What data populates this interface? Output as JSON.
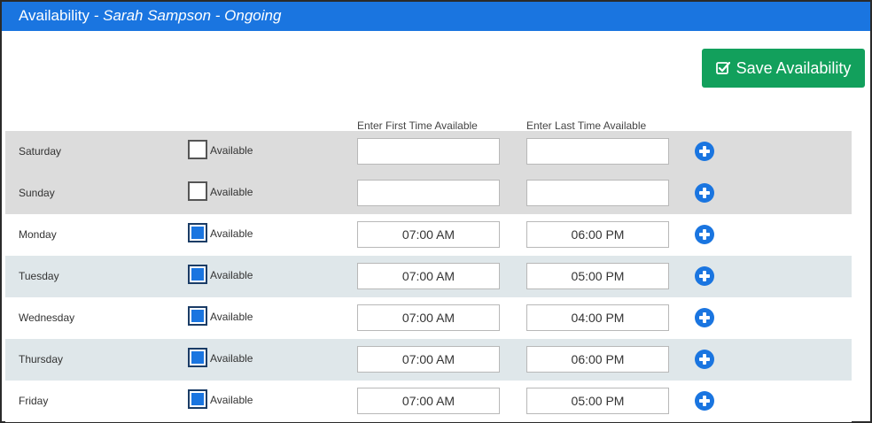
{
  "header": {
    "title_prefix": "Availability",
    "separator_1": " - ",
    "person_name": "Sarah Sampson",
    "separator_2": " - ",
    "status": "Ongoing"
  },
  "toolbar": {
    "save_label": "Save Availability",
    "save_icon": "check-square-icon"
  },
  "columns": {
    "first_time": "Enter First Time Available",
    "last_time": "Enter Last Time Available"
  },
  "days": [
    {
      "day": "Saturday",
      "available_label": "Available",
      "checked": false,
      "first_time": "",
      "last_time": "",
      "add_icon": "plus-circle-icon"
    },
    {
      "day": "Sunday",
      "available_label": "Available",
      "checked": false,
      "first_time": "",
      "last_time": "",
      "add_icon": "plus-circle-icon"
    },
    {
      "day": "Monday",
      "available_label": "Available",
      "checked": true,
      "first_time": "07:00 AM",
      "last_time": "06:00 PM",
      "add_icon": "plus-circle-icon"
    },
    {
      "day": "Tuesday",
      "available_label": "Available",
      "checked": true,
      "first_time": "07:00 AM",
      "last_time": "05:00 PM",
      "add_icon": "plus-circle-icon"
    },
    {
      "day": "Wednesday",
      "available_label": "Available",
      "checked": true,
      "first_time": "07:00 AM",
      "last_time": "04:00 PM",
      "add_icon": "plus-circle-icon"
    },
    {
      "day": "Thursday",
      "available_label": "Available",
      "checked": true,
      "first_time": "07:00 AM",
      "last_time": "06:00 PM",
      "add_icon": "plus-circle-icon"
    },
    {
      "day": "Friday",
      "available_label": "Available",
      "checked": true,
      "first_time": "07:00 AM",
      "last_time": "05:00 PM",
      "add_icon": "plus-circle-icon"
    }
  ],
  "colors": {
    "header_bg": "#1a75e0",
    "save_bg": "#12a05c",
    "unavailable_row": "#dcdcdc",
    "alt_row": "#dfe7ea",
    "plus_icon": "#1a75e0"
  }
}
